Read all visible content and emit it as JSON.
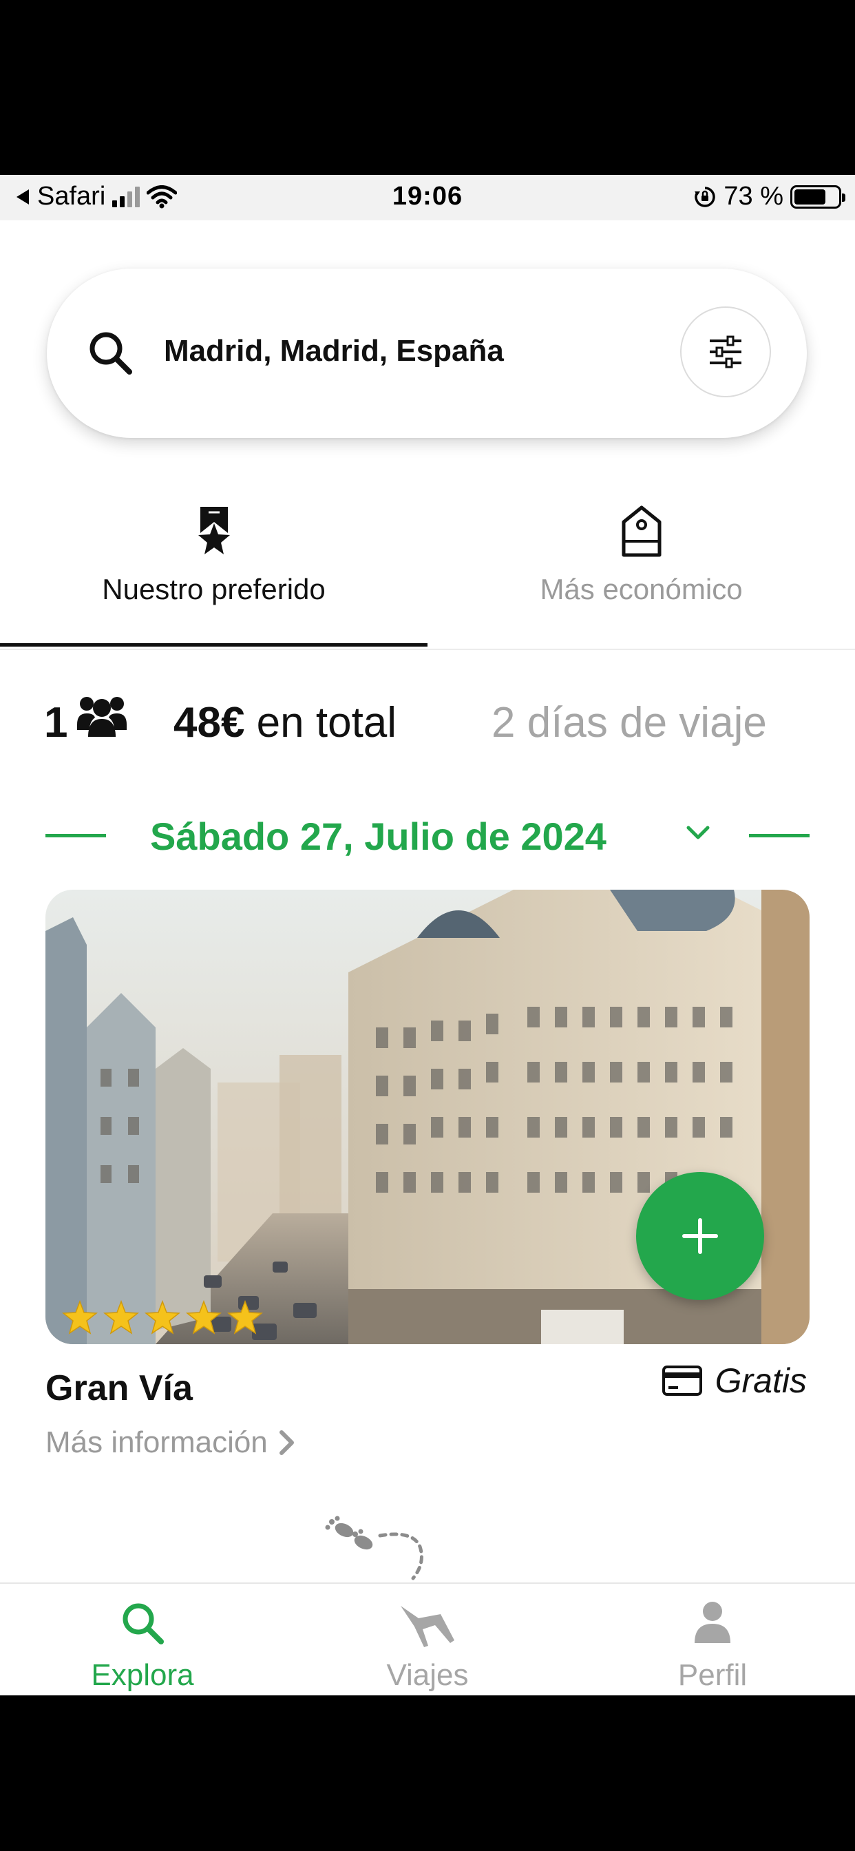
{
  "status_bar": {
    "back_app": "Safari",
    "time": "19:06",
    "battery_text": "73 %",
    "battery_level": 0.73
  },
  "search": {
    "location": "Madrid, Madrid, España"
  },
  "tabs": [
    {
      "label": "Nuestro preferido",
      "icon": "award-icon",
      "active": true
    },
    {
      "label": "Más económico",
      "icon": "price-tag-icon",
      "active": false
    }
  ],
  "summary": {
    "people": "1",
    "price": "48€",
    "price_suffix": " en total",
    "duration": "2 días de viaje"
  },
  "date": {
    "label": "Sábado 27, Julio de 2024"
  },
  "card": {
    "name": "Gran Vía",
    "price": "Gratis",
    "more_info": "Más información",
    "rating": 5
  },
  "bottom_nav": [
    {
      "label": "Explora",
      "icon": "search-icon",
      "active": true
    },
    {
      "label": "Viajes",
      "icon": "plane-icon",
      "active": false
    },
    {
      "label": "Perfil",
      "icon": "user-icon",
      "active": false
    }
  ],
  "colors": {
    "accent": "#23a74c",
    "star": "#f5c21b",
    "muted": "#9a9a9a"
  }
}
